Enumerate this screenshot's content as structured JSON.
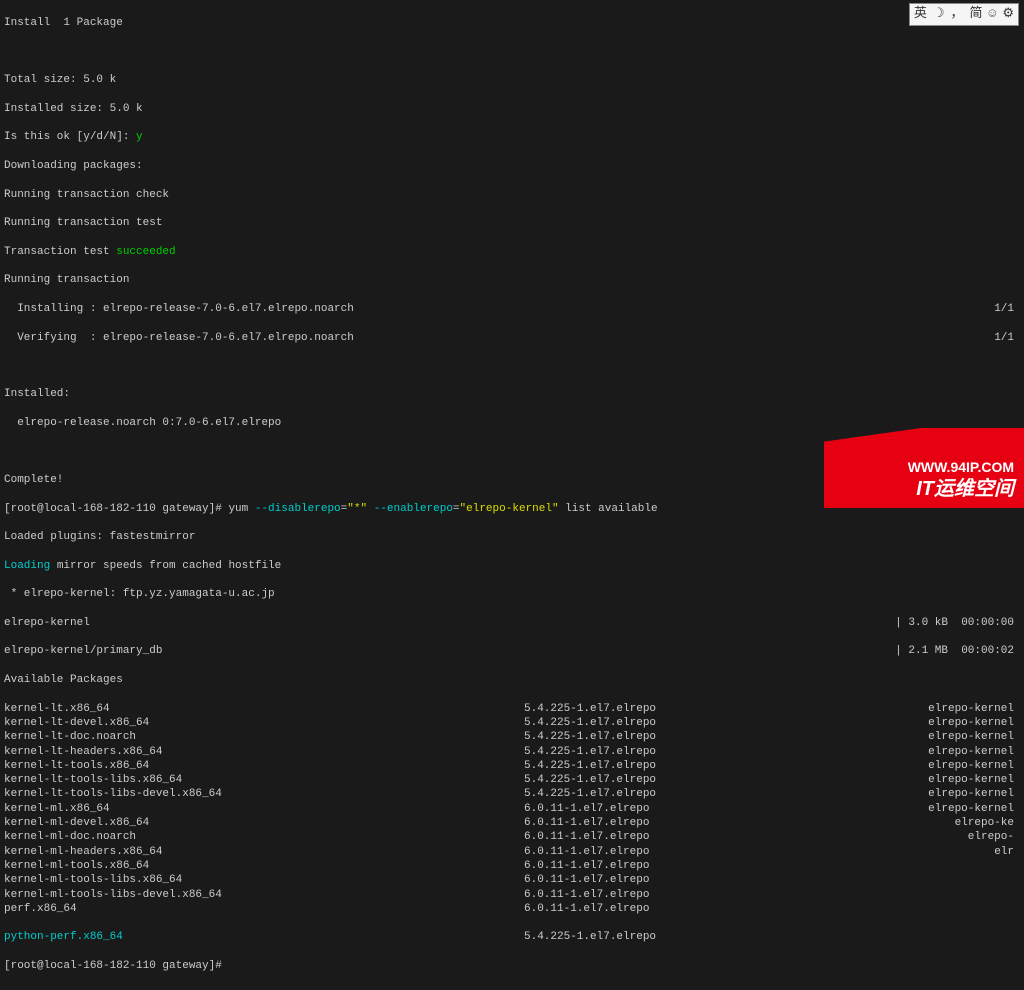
{
  "ime": {
    "lang": "英",
    "moon": "☽",
    "comma": "，",
    "mode": "简",
    "smile": "☺",
    "gear": "⚙"
  },
  "header": {
    "install": "Install  1 Package",
    "blank1": "",
    "total_size": "Total size: 5.0 k",
    "installed_size": "Installed size: 5.0 k",
    "is_ok": "Is this ok [y/d/N]: ",
    "is_ok_answer": "y",
    "downloading": "Downloading packages:",
    "run_check": "Running transaction check",
    "run_test": "Running transaction test",
    "trans_test": "Transaction test ",
    "succeeded": "succeeded",
    "running": "Running transaction",
    "installing": "  Installing : elrepo-release-7.0-6.el7.elrepo.noarch",
    "installing_frac": "1/1",
    "verifying": "  Verifying  : elrepo-release-7.0-6.el7.elrepo.noarch",
    "verifying_frac": "1/1",
    "blank2": "",
    "installed": "Installed:",
    "installed_pkg": "  elrepo-release.noarch 0:7.0-6.el7.elrepo",
    "blank3": "",
    "complete": "Complete!"
  },
  "prompt1": {
    "userhost": "[root@local-168-182-110 gateway]# ",
    "cmd1": "yum ",
    "flag1": "--disablerepo",
    "eq1": "=",
    "val1": "\"*\"",
    "sp1": " ",
    "flag2": "--enablerepo",
    "eq2": "=",
    "val2": "\"elrepo-kernel\"",
    "rest": " list available"
  },
  "plugins": "Loaded plugins: fastestmirror",
  "loading": "Loading",
  "loading_rest": " mirror speeds from cached hostfile",
  "mirror": " * elrepo-kernel: ftp.yz.yamagata-u.ac.jp",
  "repo1": {
    "name": "elrepo-kernel",
    "size": "| 3.0 kB",
    "time": "00:00:00"
  },
  "repo2": {
    "name": "elrepo-kernel/primary_db",
    "size": "| 2.1 MB",
    "time": "00:00:02"
  },
  "available": "Available Packages",
  "packages": [
    {
      "name": "kernel-lt.x86_64",
      "version": "5.4.225-1.el7.elrepo",
      "repo": "elrepo-kernel"
    },
    {
      "name": "kernel-lt-devel.x86_64",
      "version": "5.4.225-1.el7.elrepo",
      "repo": "elrepo-kernel"
    },
    {
      "name": "kernel-lt-doc.noarch",
      "version": "5.4.225-1.el7.elrepo",
      "repo": "elrepo-kernel"
    },
    {
      "name": "kernel-lt-headers.x86_64",
      "version": "5.4.225-1.el7.elrepo",
      "repo": "elrepo-kernel"
    },
    {
      "name": "kernel-lt-tools.x86_64",
      "version": "5.4.225-1.el7.elrepo",
      "repo": "elrepo-kernel"
    },
    {
      "name": "kernel-lt-tools-libs.x86_64",
      "version": "5.4.225-1.el7.elrepo",
      "repo": "elrepo-kernel"
    },
    {
      "name": "kernel-lt-tools-libs-devel.x86_64",
      "version": "5.4.225-1.el7.elrepo",
      "repo": "elrepo-kernel"
    },
    {
      "name": "kernel-ml.x86_64",
      "version": "6.0.11-1.el7.elrepo",
      "repo": "elrepo-kernel"
    },
    {
      "name": "kernel-ml-devel.x86_64",
      "version": "6.0.11-1.el7.elrepo",
      "repo": "elrepo-ke"
    },
    {
      "name": "kernel-ml-doc.noarch",
      "version": "6.0.11-1.el7.elrepo",
      "repo": "elrepo-"
    },
    {
      "name": "kernel-ml-headers.x86_64",
      "version": "6.0.11-1.el7.elrepo",
      "repo": "elr"
    },
    {
      "name": "kernel-ml-tools.x86_64",
      "version": "6.0.11-1.el7.elrepo",
      "repo": ""
    },
    {
      "name": "kernel-ml-tools-libs.x86_64",
      "version": "6.0.11-1.el7.elrepo",
      "repo": ""
    },
    {
      "name": "kernel-ml-tools-libs-devel.x86_64",
      "version": "6.0.11-1.el7.elrepo",
      "repo": ""
    },
    {
      "name": "perf.x86_64",
      "version": "6.0.11-1.el7.elrepo",
      "repo": ""
    }
  ],
  "python_perf": {
    "name": "python-perf.x86_64",
    "version": "5.4.225-1.el7.elrepo"
  },
  "prompt2": "[root@local-168-182-110 gateway]# ",
  "watermark": {
    "url": "WWW.94IP.COM",
    "text": "IT运维空间"
  }
}
